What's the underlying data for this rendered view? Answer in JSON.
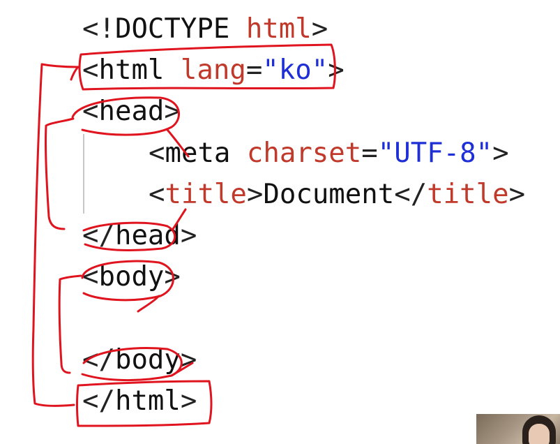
{
  "code": {
    "lines": [
      [
        {
          "text": "<!",
          "role": "punct"
        },
        {
          "text": "DOCTYPE",
          "role": "text"
        },
        {
          "text": " ",
          "role": "text"
        },
        {
          "text": "html",
          "role": "tag"
        },
        {
          "text": ">",
          "role": "punct"
        }
      ],
      [
        {
          "text": "<",
          "role": "punct"
        },
        {
          "text": "html",
          "role": "text"
        },
        {
          "text": " ",
          "role": "text"
        },
        {
          "text": "lang",
          "role": "attr"
        },
        {
          "text": "=",
          "role": "punct"
        },
        {
          "text": "\"ko\"",
          "role": "str"
        },
        {
          "text": ">",
          "role": "punct"
        }
      ],
      [
        {
          "text": "<",
          "role": "punct"
        },
        {
          "text": "head",
          "role": "text"
        },
        {
          "text": ">",
          "role": "punct"
        }
      ],
      [
        {
          "text": "<",
          "role": "punct"
        },
        {
          "text": "meta",
          "role": "text"
        },
        {
          "text": " ",
          "role": "text"
        },
        {
          "text": "charset",
          "role": "attr"
        },
        {
          "text": "=",
          "role": "punct"
        },
        {
          "text": "\"UTF-8\"",
          "role": "str"
        },
        {
          "text": ">",
          "role": "punct"
        }
      ],
      [
        {
          "text": "<",
          "role": "punct"
        },
        {
          "text": "title",
          "role": "tag"
        },
        {
          "text": ">",
          "role": "punct"
        },
        {
          "text": "Document",
          "role": "text"
        },
        {
          "text": "</",
          "role": "punct"
        },
        {
          "text": "title",
          "role": "tag"
        },
        {
          "text": ">",
          "role": "punct"
        }
      ],
      [
        {
          "text": "</",
          "role": "punct"
        },
        {
          "text": "head",
          "role": "text"
        },
        {
          "text": ">",
          "role": "punct"
        }
      ],
      [
        {
          "text": "<",
          "role": "punct"
        },
        {
          "text": "body",
          "role": "text"
        },
        {
          "text": ">",
          "role": "punct"
        }
      ],
      [
        {
          "text": "</",
          "role": "punct"
        },
        {
          "text": "body",
          "role": "text"
        },
        {
          "text": ">",
          "role": "punct"
        }
      ],
      [
        {
          "text": "</",
          "role": "punct"
        },
        {
          "text": "html",
          "role": "text"
        },
        {
          "text": ">",
          "role": "punct"
        }
      ]
    ]
  },
  "colors": {
    "punct": "#222222",
    "tag": "#c0392b",
    "attr": "#c0392b",
    "str": "#1f2fd6",
    "text": "#111111",
    "annotation_ink": "#e0141e",
    "indent_guide": "#c8c8c8",
    "background": "#ffffff"
  },
  "annotation": {
    "tool": "freehand-pen",
    "color_name": "red"
  },
  "webcam": {
    "icon": "webcam-thumbnail"
  }
}
